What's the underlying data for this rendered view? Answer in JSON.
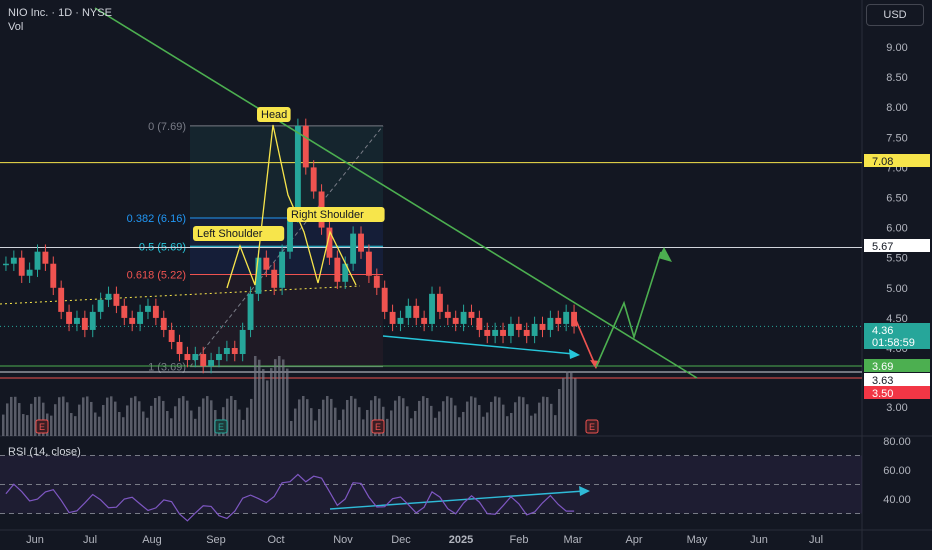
{
  "header": {
    "title": "NIO Inc. · 1D · NYSE",
    "vol_label": "Vol"
  },
  "currency_button": "USD",
  "rsi_label": "RSI (14, close)",
  "colors": {
    "bg": "#131722",
    "up": "#26a69a",
    "down": "#ef5350",
    "trend": "#4caf50",
    "yellow": "#f7e54b",
    "fib": "#2196f3",
    "rsi": "#7e57c2",
    "cyan": "#26c6da"
  },
  "chart_data": {
    "type": "candlestick",
    "price_axis": {
      "ticks": [
        "9.00",
        "8.50",
        "8.00",
        "7.50",
        "7.00",
        "6.50",
        "6.00",
        "5.50",
        "5.00",
        "4.50",
        "4.00",
        "3.00"
      ],
      "ylim": [
        3.0,
        9.0
      ]
    },
    "rsi_axis": {
      "ticks": [
        "80.00",
        "60.00",
        "40.00"
      ],
      "ylim": [
        20,
        80
      ]
    },
    "x_ticks": [
      "Jun",
      "Jul",
      "Aug",
      "Sep",
      "Oct",
      "Nov",
      "Dec",
      "2025",
      "Feb",
      "Mar",
      "Apr",
      "May",
      "Jun",
      "Jul"
    ],
    "price_labels": [
      {
        "value": 7.08,
        "text": "7.08",
        "style": "yellow"
      },
      {
        "value": 5.67,
        "text": "5.67",
        "style": "white"
      },
      {
        "value": 4.36,
        "text": "4.36",
        "sub": "01:58:59",
        "style": "teal"
      },
      {
        "value": 3.69,
        "text": "3.69",
        "style": "green"
      },
      {
        "value": 3.63,
        "text": "3.63",
        "style": "white"
      },
      {
        "value": 3.5,
        "text": "3.50",
        "style": "red"
      }
    ],
    "fib_levels": [
      {
        "text": "0 (7.69)",
        "value": 7.69
      },
      {
        "text": "0.382 (6.16)",
        "value": 6.16
      },
      {
        "text": "0.5 (5.69)",
        "value": 5.69
      },
      {
        "text": "0.618 (5.22)",
        "value": 5.22
      },
      {
        "text": "1 (3.69)",
        "value": 3.69
      }
    ],
    "annotations": [
      {
        "text": "Head",
        "date": "Oct",
        "value": 7.95
      },
      {
        "text": "Left Shoulder",
        "date": "Sep",
        "value": 5.9
      },
      {
        "text": "Right Shoulder",
        "date": "Oct",
        "value": 6.2
      }
    ],
    "earnings_markers": [
      "E",
      "E",
      "E",
      "E"
    ],
    "close_series": [
      5.4,
      5.5,
      5.2,
      5.3,
      5.6,
      5.4,
      5.0,
      4.6,
      4.4,
      4.5,
      4.3,
      4.6,
      4.8,
      4.9,
      4.7,
      4.5,
      4.4,
      4.6,
      4.7,
      4.5,
      4.3,
      4.1,
      3.9,
      3.8,
      3.9,
      3.7,
      3.8,
      3.9,
      4.0,
      3.9,
      4.3,
      4.9,
      5.5,
      5.3,
      5.0,
      5.6,
      6.2,
      7.69,
      7.0,
      6.6,
      6.0,
      5.5,
      5.1,
      5.4,
      5.9,
      5.6,
      5.2,
      5.0,
      4.6,
      4.4,
      4.5,
      4.7,
      4.5,
      4.4,
      4.9,
      4.6,
      4.5,
      4.4,
      4.6,
      4.5,
      4.3,
      4.2,
      4.3,
      4.2,
      4.4,
      4.3,
      4.2,
      4.4,
      4.3,
      4.5,
      4.4,
      4.6,
      4.36
    ]
  }
}
